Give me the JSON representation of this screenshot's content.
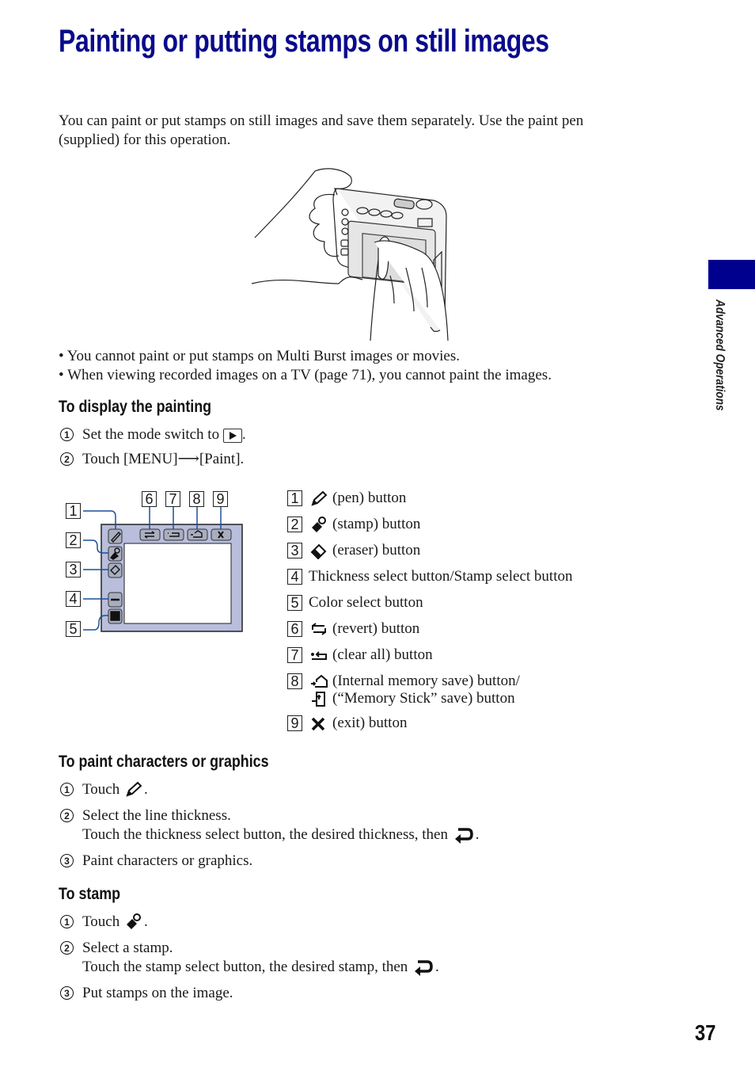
{
  "page": {
    "title": "Painting or putting stamps on still images",
    "intro": [
      "You can paint or put stamps on still images and save them separately. Use the paint pen",
      "(supplied) for this operation."
    ],
    "illustration": "hands-holding-camera-with-paint-pen",
    "notes": [
      "You cannot paint or put stamps on Multi Burst images or movies.",
      "When viewing recorded images on a TV (page 71), you cannot paint the images."
    ],
    "bullet": "•",
    "side_tab": {
      "label": "Advanced Operations",
      "color": "#00008f"
    },
    "page_number": "37",
    "title_color": "#0a0a8c"
  },
  "display_section": {
    "heading": "To display the painting",
    "steps": [
      {
        "num": "1",
        "text": "Set the mode switch to",
        "icon": "playback-icon",
        "suffix": "."
      },
      {
        "num": "2",
        "text": "Touch [MENU] ",
        "arrow": "⟶",
        "text2": " [Paint]."
      }
    ]
  },
  "diagram": {
    "callouts_left": [
      "1",
      "2",
      "3",
      "4",
      "5"
    ],
    "callouts_top": [
      "6",
      "7",
      "8",
      "9"
    ],
    "panel_color": "#b8bedc",
    "button_color": "#a9aebf"
  },
  "legend": [
    {
      "num": "1",
      "icon": "pen-icon",
      "text": "(pen) button"
    },
    {
      "num": "2",
      "icon": "stamp-icon",
      "text": "(stamp) button"
    },
    {
      "num": "3",
      "icon": "eraser-icon",
      "text": "(eraser) button"
    },
    {
      "num": "4",
      "icon": "",
      "text": "Thickness select button/Stamp select button"
    },
    {
      "num": "5",
      "icon": "",
      "text": "Color select button"
    },
    {
      "num": "6",
      "icon": "revert-icon",
      "text": "(revert) button"
    },
    {
      "num": "7",
      "icon": "clear-all-icon",
      "text": "(clear all) button"
    },
    {
      "num": "8",
      "icon": "internal-memory-save-icon",
      "text": "(Internal memory save) button/",
      "sub_icon": "memory-stick-save-icon",
      "sub_text": "(“Memory Stick” save) button"
    },
    {
      "num": "9",
      "icon": "exit-icon",
      "text": "(exit) button"
    }
  ],
  "paint_section": {
    "heading": "To paint characters or graphics",
    "steps": [
      {
        "num": "1",
        "text": "Touch",
        "icon": "pen-icon",
        "suffix": "."
      },
      {
        "num": "2",
        "text": "Select the line thickness.",
        "line2": "Touch the thickness select button, the desired thickness, then",
        "icon": "return-icon",
        "suffix": "."
      },
      {
        "num": "3",
        "text": "Paint characters or graphics."
      }
    ]
  },
  "stamp_section": {
    "heading": "To stamp",
    "steps": [
      {
        "num": "1",
        "text": "Touch",
        "icon": "stamp-icon",
        "suffix": "."
      },
      {
        "num": "2",
        "text": "Select a stamp.",
        "line2": "Touch the stamp select button, the desired stamp, then",
        "icon": "return-icon",
        "suffix": "."
      },
      {
        "num": "3",
        "text": "Put stamps on the image."
      }
    ]
  }
}
